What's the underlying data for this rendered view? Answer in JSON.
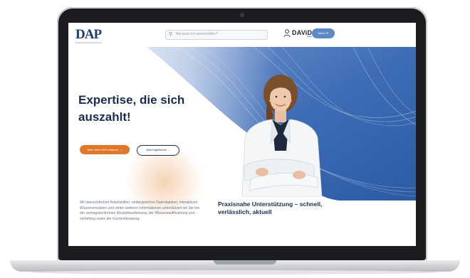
{
  "header": {
    "logo_text": "DAP",
    "logo_subtext": "DeutschesApothekenPortal",
    "search_placeholder": "Wo kann ich weiterhelfen?",
    "brand_name": "DAViD",
    "brand_sub": "login",
    "menu_label": "Menü ☰"
  },
  "hero": {
    "headline": "Expertise, die sich auszahlt!",
    "primary_button": "Mehr über DAP erfahren →",
    "secondary_button": "Jetzt registrieren →",
    "body_text": "Mit übersichtlichen Arbeitshilfen, umfangreichen Datenbanken, interaktiven Wissensmodulen und vielen weiteren Informationen unterstützen wir Sie bei der vertragskonformen Rezeptbearbeitung, der Wissensauffrischung und -vertiefung sowie der Kundenberatung.",
    "caption": "Praxisnahe Unterstützung – schnell, verlässlich, aktuell"
  },
  "colors": {
    "navy": "#1b2d4d",
    "accent_orange": "#e0782a",
    "accent_blue": "#5c88c4",
    "hero_blue": "#3f6db5"
  },
  "icons": [
    "search-icon",
    "user-icon",
    "menu-icon"
  ]
}
